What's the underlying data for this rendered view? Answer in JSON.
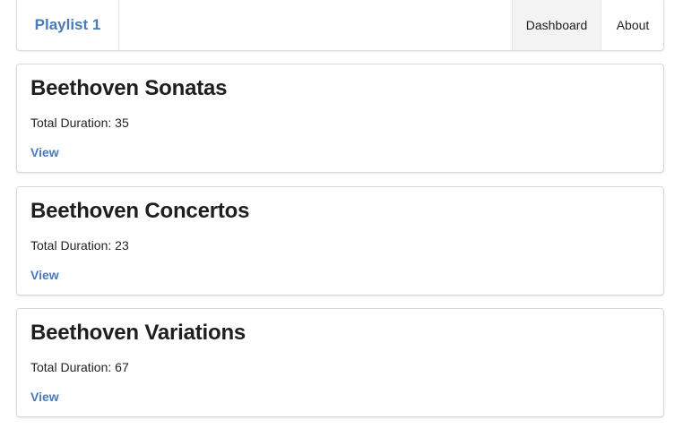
{
  "navbar": {
    "brand": "Playlist 1",
    "items": [
      {
        "label": "Dashboard",
        "active": true
      },
      {
        "label": "About",
        "active": false
      }
    ]
  },
  "playlists": [
    {
      "title": "Beethoven Sonatas",
      "duration_label": "Total Duration:",
      "duration": "35",
      "link_label": "View"
    },
    {
      "title": "Beethoven Concertos",
      "duration_label": "Total Duration:",
      "duration": "23",
      "link_label": "View"
    },
    {
      "title": "Beethoven Variations",
      "duration_label": "Total Duration:",
      "duration": "67",
      "link_label": "View"
    }
  ],
  "colors": {
    "accent": "#4a7ab8",
    "active_nav_background": "#f3f3f3"
  }
}
